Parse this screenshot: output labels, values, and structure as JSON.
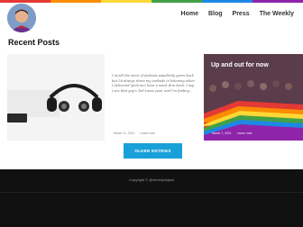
{
  "colors": {
    "strip": [
      "#e53935",
      "#fb8c00",
      "#fdd835",
      "#43a047",
      "#1e88e5",
      "#8e24aa"
    ],
    "accent": "#1aa0d8",
    "footer_bg": "#111111"
  },
  "header": {
    "avatar_icon": "profile-photo",
    "nav": [
      "Home",
      "Blog",
      "Press",
      "The Weekly"
    ]
  },
  "main": {
    "section_title": "Recent Posts",
    "posts": [
      {
        "image": "headphones-and-phone-photo",
        "excerpt": "",
        "date": "",
        "comments": ""
      },
      {
        "image": "",
        "excerpt": "I recall the store of podcast popularity years back but I'd always share my earbuds in listening when I delivered (pick-me) have a week firm back. I say, I see that guy's Ted-Lasso post, and I'm finding...",
        "date": "March 11, 2021",
        "comments": "Leave note"
      },
      {
        "image": "pride-parade-crowd-photo",
        "title": "Up and out for now",
        "date": "March 7, 2021",
        "comments": "Leave note"
      }
    ],
    "older_button": "OLDER ENTRIES"
  },
  "footer": {
    "copyright": "Copyright © @devinlyncjack"
  }
}
